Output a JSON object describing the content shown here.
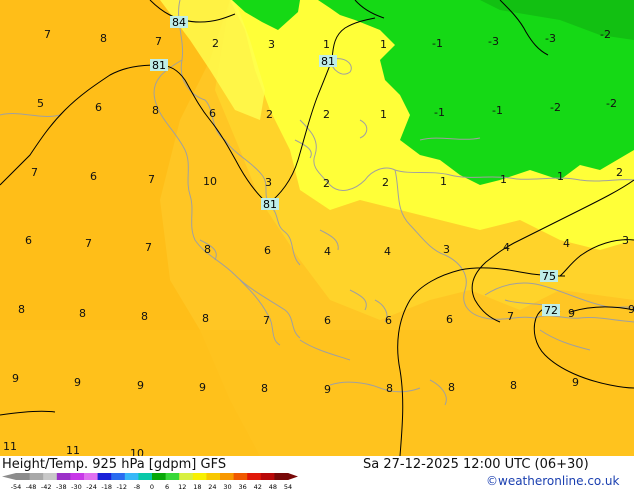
{
  "title": "Height/Temp. 925 hPa [gdpm] GFS",
  "run_time": "Sa 27-12-2025 12:00 UTC (06+30)",
  "credit": "©weatheronline.co.uk",
  "contour_labels": [
    "84",
    "81",
    "81",
    "81",
    "75",
    "72"
  ],
  "temperature_values": [
    "7",
    "8",
    "7",
    "2",
    "3",
    "1",
    "1",
    "-1",
    "-3",
    "-3",
    "-2",
    "5",
    "6",
    "8",
    "6",
    "2",
    "2",
    "1",
    "-1",
    "-1",
    "-2",
    "-2",
    "7",
    "6",
    "7",
    "10",
    "3",
    "2",
    "2",
    "1",
    "1",
    "1",
    "2",
    "6",
    "7",
    "7",
    "8",
    "6",
    "4",
    "4",
    "3",
    "4",
    "4",
    "3",
    "8",
    "8",
    "8",
    "8",
    "7",
    "6",
    "6",
    "6",
    "7",
    "9",
    "9",
    "9",
    "9",
    "9",
    "9",
    "8",
    "9",
    "8",
    "8",
    "8",
    "9",
    "11",
    "11",
    "10"
  ],
  "color_scale": {
    "ticks": [
      "-54",
      "-48",
      "-42",
      "-38",
      "-30",
      "-24",
      "-18",
      "-12",
      "-8",
      "0",
      "6",
      "12",
      "18",
      "24",
      "30",
      "36",
      "42",
      "48",
      "54"
    ],
    "colors": [
      "#8c8c8c",
      "#a8a8a8",
      "#c8c8c8",
      "#9b30c8",
      "#c838e8",
      "#e070f0",
      "#1a20d8",
      "#2a6cf0",
      "#38b8f8",
      "#08c8a8",
      "#08a808",
      "#38d838",
      "#d8f040",
      "#f8f000",
      "#f8c800",
      "#f89800",
      "#f05800",
      "#e01808",
      "#b80808",
      "#780808"
    ]
  },
  "fills": {
    "land": "#ffc21a",
    "sea": "#ffd21e",
    "yellow_zone": "#ffff38",
    "green_zone": "#15d915",
    "green_edge": "#13c413"
  }
}
